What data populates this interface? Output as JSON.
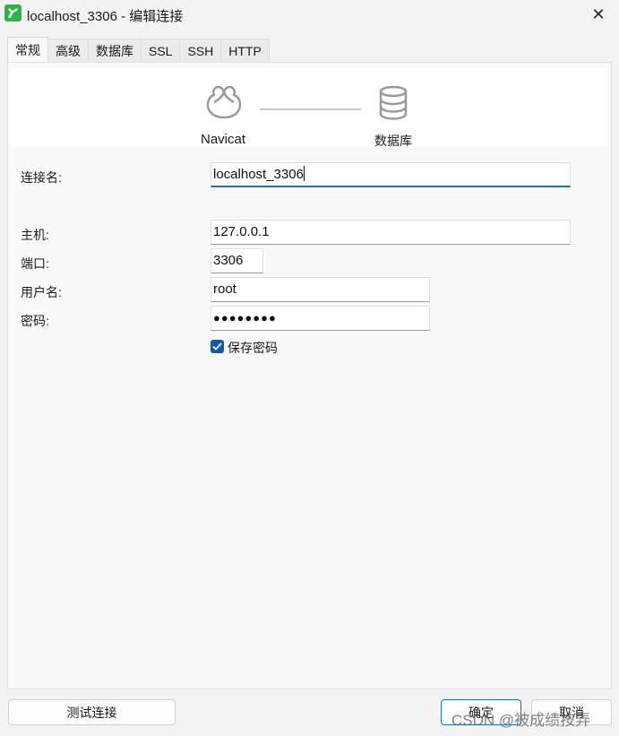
{
  "window": {
    "title": "localhost_3306 - 编辑连接",
    "close_glyph": "✕",
    "app_icon": "navicat-app-icon"
  },
  "tabs": [
    {
      "label": "常规",
      "active": true
    },
    {
      "label": "高级",
      "active": false
    },
    {
      "label": "数据库",
      "active": false
    },
    {
      "label": "SSL",
      "active": false
    },
    {
      "label": "SSH",
      "active": false
    },
    {
      "label": "HTTP",
      "active": false
    }
  ],
  "header": {
    "left_label": "Navicat",
    "right_label": "数据库",
    "left_icon": "navicat-logo-icon",
    "right_icon": "database-icon"
  },
  "form": {
    "connection_name": {
      "label": "连接名:",
      "value": "localhost_3306"
    },
    "host": {
      "label": "主机:",
      "value": "127.0.0.1"
    },
    "port": {
      "label": "端口:",
      "value": "3306"
    },
    "username": {
      "label": "用户名:",
      "value": "root"
    },
    "password": {
      "label": "密码:",
      "value": "●●●●●●●●"
    },
    "save_password": {
      "label": "保存密码",
      "checked": true
    }
  },
  "footer": {
    "test_button": "测试连接",
    "ok_button": "确定",
    "cancel_button": "取消"
  },
  "watermark": "CSDN @被成绩按弄",
  "colors": {
    "accent": "#1f6ec4",
    "checkbox": "#0b5cad",
    "app_icon_green": "#2fb344",
    "background": "#f3f3f3",
    "panel": "#f9f9f9"
  }
}
